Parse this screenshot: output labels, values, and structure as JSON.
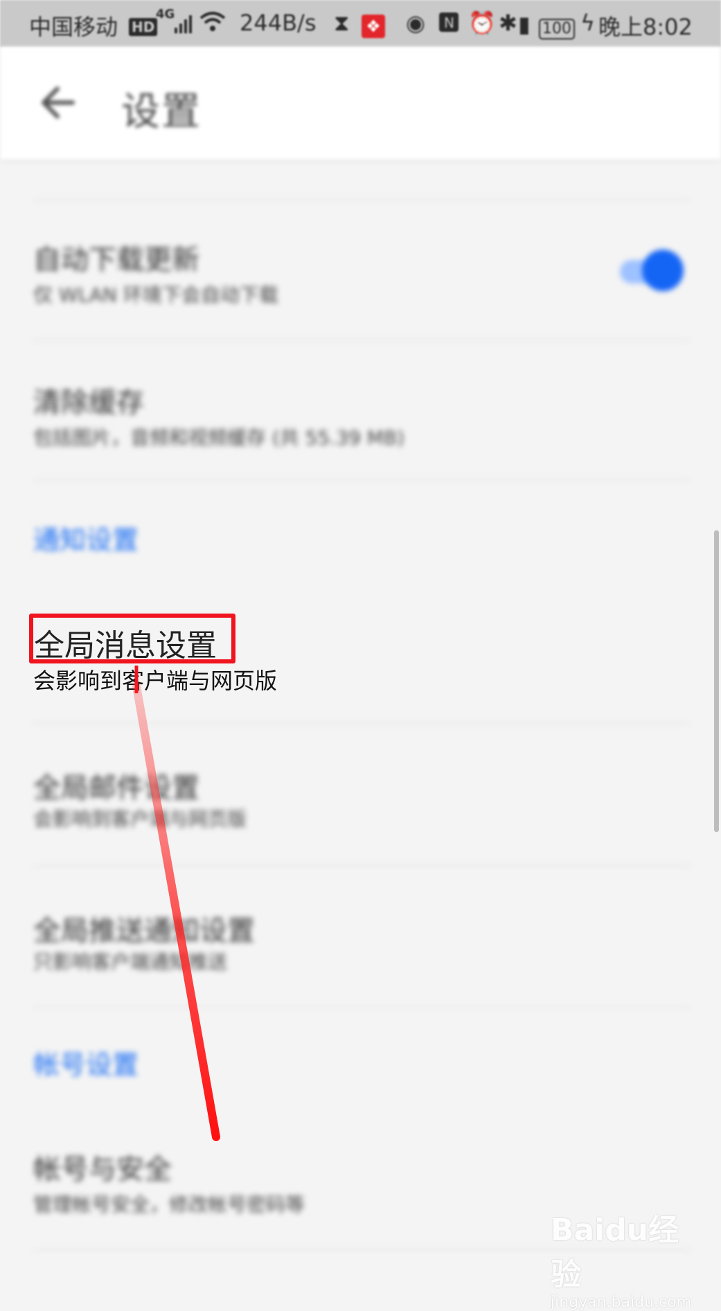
{
  "status_bar": {
    "carrier": "中国移动",
    "network_badge": "HD",
    "network_gen": "4G",
    "speed": "244B/s",
    "battery": "100",
    "time": "晚上8:02",
    "icons": [
      "signal-icon",
      "wifi-icon",
      "hourglass-icon",
      "app-badge-icon",
      "eye-icon",
      "nfc-icon",
      "alarm-icon",
      "bluetooth-icon",
      "battery-icon",
      "charging-icon"
    ]
  },
  "app_bar": {
    "title": "设置",
    "back_icon": "back-arrow-icon"
  },
  "items": {
    "auto_update": {
      "title": "自动下载更新",
      "subtitle": "仅 WLAN 环境下会自动下载",
      "toggle_on": true
    },
    "clear_cache": {
      "title": "清除缓存",
      "subtitle": "包括图片，音频和视频缓存 (共 55.39 MB)"
    },
    "notification_section": "通知设置",
    "global_message": {
      "title": "全局消息设置",
      "subtitle": "会影响到客户端与网页版"
    },
    "global_mail": {
      "title": "全局邮件设置",
      "subtitle": "会影响到客户端与网页版"
    },
    "global_push": {
      "title": "全局推送通知设置",
      "subtitle": "只影响客户端通知推送"
    },
    "account_section": "帐号设置",
    "account_security": {
      "title": "帐号与安全",
      "subtitle": "管理帐号安全，修改帐号密码等"
    }
  },
  "watermark": {
    "logo": "Baidu经验",
    "url": "jingyan.baidu.com"
  },
  "colors": {
    "accent": "#1a6ef5",
    "highlight": "#f0141e",
    "background": "#f4f4f4"
  }
}
